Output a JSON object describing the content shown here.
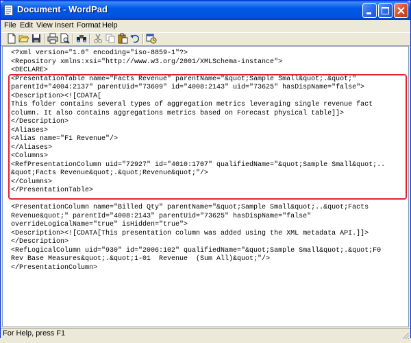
{
  "window": {
    "title": "Document - WordPad",
    "accent": "#0058e6",
    "close_color": "#d9512d"
  },
  "menubar": {
    "items": [
      "File",
      "Edit",
      "View",
      "Insert",
      "Format",
      "Help"
    ]
  },
  "toolbar": {
    "tools": [
      "new-document-icon",
      "open-folder-icon",
      "save-icon",
      "print-icon",
      "print-preview-icon",
      "find-icon",
      "cut-icon",
      "copy-icon",
      "paste-icon",
      "undo-icon",
      "date-time-icon"
    ]
  },
  "document": {
    "highlight_color": "#e8202a",
    "lines": [
      "<?xml version=\"1.0\" encoding=\"iso-8859-1\"?>",
      "<Repository xmlns:xsi=\"http://www.w3.org/2001/XMLSchema-instance\">",
      "<DECLARE>",
      "<PresentationTable name=\"Facts Revenue\" parentName=\"&quot;Sample Small&quot;.&quot;\"",
      "parentId=\"4004:2137\" parentUid=\"73609\" id=\"4008:2143\" uid=\"73625\" hasDispName=\"false\">",
      "<Description><![CDATA[",
      "This folder contains several types of aggregation metrics leveraging single revenue fact",
      "column. It also contains aggregations metrics based on Forecast physical table]]>",
      "</Description>",
      "<Aliases>",
      "<Alias name=\"F1 Revenue\"/>",
      "</Aliases>",
      "<Columns>",
      "<RefPresentationColumn uid=\"72927\" id=\"4010:1707\" qualifiedName=\"&quot;Sample Small&quot;..",
      "&quot;Facts Revenue&quot;.&quot;Revenue&quot;\"/>",
      "</Columns>",
      "</PresentationTable>",
      "",
      "<PresentationColumn name=\"Billed Qty\" parentName=\"&quot;Sample Small&quot;..&quot;Facts",
      "Revenue&quot;\" parentId=\"4008:2143\" parentUid=\"73625\" hasDispName=\"false\"",
      "overrideLogicalName=\"true\" isHidden=\"true\">",
      "<Description><![CDATA[This presentation column was added using the XML metadata API.]]>",
      "</Description>",
      "<RefLogicalColumn uid=\"930\" id=\"2006:102\" qualifiedName=\"&quot;Sample Small&quot;.&quot;F0",
      "Rev Base Measures&quot;.&quot;1-01  Revenue  (Sum All)&quot;\"/>",
      "</PresentationColumn>"
    ]
  },
  "statusbar": {
    "text": "For Help, press F1"
  }
}
